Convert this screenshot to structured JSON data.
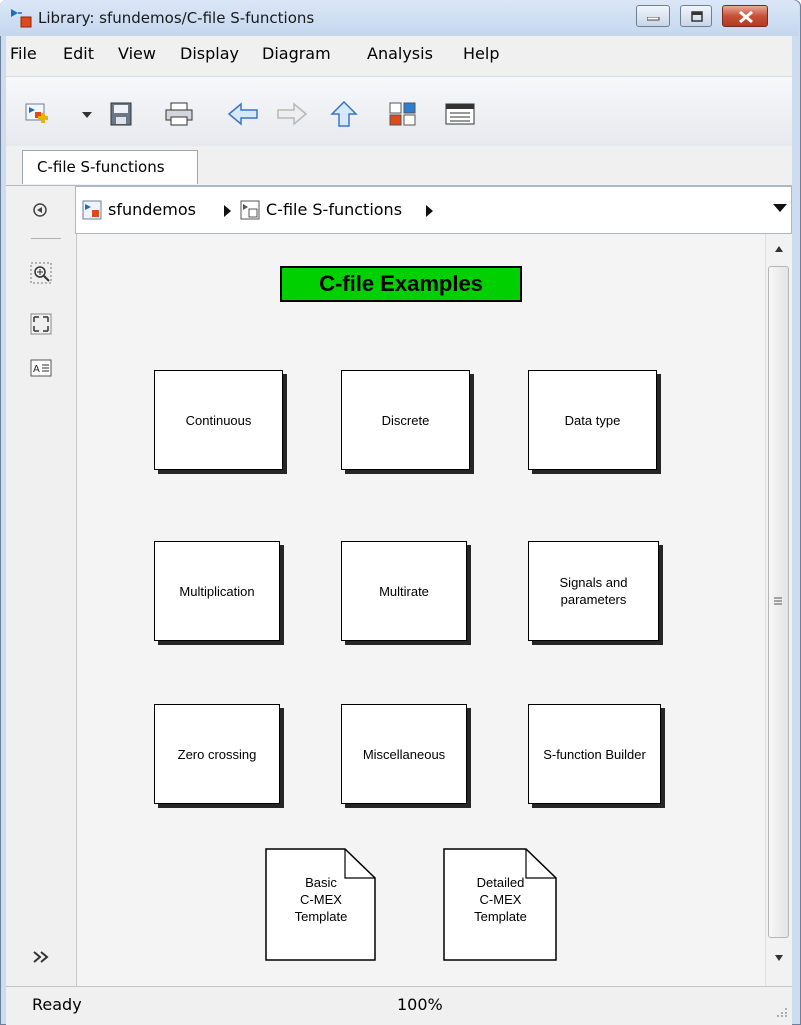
{
  "window": {
    "title": "Library: sfundemos/C-file S-functions",
    "icon": "simulink-library-icon",
    "controls": {
      "minimize": "minimize-icon",
      "maximize": "maximize-icon",
      "close": "close-icon"
    }
  },
  "menubar": {
    "items": [
      {
        "label": "File"
      },
      {
        "label": "Edit"
      },
      {
        "label": "View"
      },
      {
        "label": "Display"
      },
      {
        "label": "Diagram"
      },
      {
        "label": "Analysis"
      },
      {
        "label": "Help"
      }
    ]
  },
  "toolbar": {
    "buttons": [
      {
        "icon": "new-model-icon"
      },
      {
        "icon": "dropdown-arrow-icon"
      },
      {
        "icon": "save-icon"
      },
      {
        "icon": "print-icon"
      },
      {
        "icon": "back-arrow-icon"
      },
      {
        "icon": "forward-arrow-icon"
      },
      {
        "icon": "up-arrow-icon"
      },
      {
        "icon": "library-browser-icon"
      },
      {
        "icon": "model-explorer-icon"
      }
    ]
  },
  "tabs": [
    {
      "label": "C-file S-functions"
    }
  ],
  "breadcrumb": {
    "items": [
      {
        "label": "sfundemos"
      },
      {
        "label": "C-file S-functions"
      }
    ]
  },
  "leftbar": {
    "icons": [
      "hide-show-browser-icon",
      "zoom-icon",
      "fit-to-view-icon",
      "annotation-icon",
      "expand-icon",
      "lock-icon"
    ]
  },
  "canvas": {
    "title": "C-file Examples",
    "blocks": [
      {
        "label": "Continuous"
      },
      {
        "label": "Discrete"
      },
      {
        "label": "Data type"
      },
      {
        "label": "Multiplication"
      },
      {
        "label": "Multirate"
      },
      {
        "label": "Signals and parameters"
      },
      {
        "label": "Zero crossing"
      },
      {
        "label": "Miscellaneous"
      },
      {
        "label": "S-function Builder"
      }
    ],
    "templates": [
      {
        "lines": [
          "Basic",
          "C-MEX",
          "Template"
        ]
      },
      {
        "lines": [
          "Detailed",
          "C-MEX",
          "Template"
        ]
      }
    ]
  },
  "status": {
    "state": "Ready",
    "zoom": "100%"
  },
  "colors": {
    "title_block": "#00d000",
    "title_bar": "#c4d7ee",
    "canvas": "#f4f4f4"
  }
}
